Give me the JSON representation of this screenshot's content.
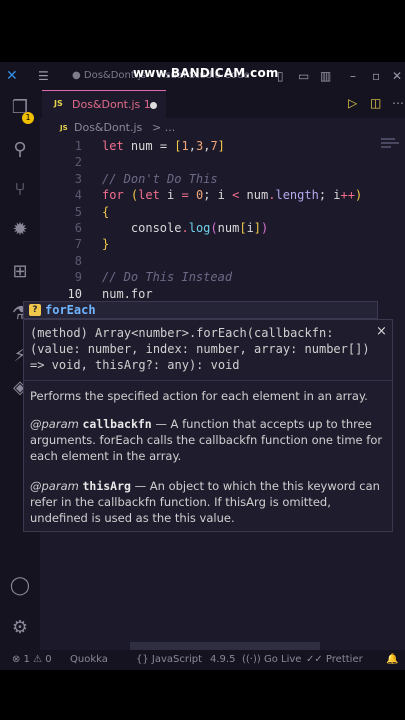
{
  "watermark": "www.BANDICAM.com",
  "window": {
    "title": "● Dos&Dont.js - Visual Studio Code"
  },
  "activity_bar": {
    "badge": "1",
    "items": [
      "files-icon",
      "search-icon",
      "source-control-icon",
      "debug-icon",
      "extensions-icon",
      "testing-icon",
      "remote-icon",
      "git-icon",
      "account-icon",
      "settings-icon"
    ]
  },
  "tab": {
    "icon": "JS",
    "label": "Dos&Dont.js 1"
  },
  "breadcrumb": {
    "icon": "JS",
    "file": "Dos&Dont.js",
    "sep": "> ..."
  },
  "code": [
    {
      "n": "1",
      "tokens": [
        [
          "kw",
          "let "
        ],
        [
          "id",
          "num "
        ],
        [
          "id",
          "= "
        ],
        [
          "br1",
          "["
        ],
        [
          "num",
          "1"
        ],
        [
          "id",
          ","
        ],
        [
          "num",
          "3"
        ],
        [
          "id",
          ","
        ],
        [
          "num",
          "7"
        ],
        [
          "br1",
          "]"
        ]
      ]
    },
    {
      "n": "2",
      "tokens": []
    },
    {
      "n": "3",
      "tokens": [
        [
          "cmt",
          "// Don't Do This"
        ]
      ]
    },
    {
      "n": "4",
      "tokens": [
        [
          "kw",
          "for "
        ],
        [
          "br1",
          "("
        ],
        [
          "kw",
          "let "
        ],
        [
          "id",
          "i "
        ],
        [
          "kw",
          "= "
        ],
        [
          "num",
          "0"
        ],
        [
          "id",
          "; i "
        ],
        [
          "kw",
          "< "
        ],
        [
          "id",
          "num"
        ],
        [
          "kw",
          "."
        ],
        [
          "prop",
          "length"
        ],
        [
          "id",
          "; i"
        ],
        [
          "kw",
          "++"
        ],
        [
          "br1",
          ")"
        ]
      ]
    },
    {
      "n": "5",
      "tokens": [
        [
          "br1",
          "{"
        ]
      ]
    },
    {
      "n": "6",
      "tokens": [
        [
          "id",
          "    console"
        ],
        [
          "kw",
          "."
        ],
        [
          "fn",
          "log"
        ],
        [
          "br2",
          "("
        ],
        [
          "id",
          "num"
        ],
        [
          "br1",
          "["
        ],
        [
          "id",
          "i"
        ],
        [
          "br1",
          "]"
        ],
        [
          "br2",
          ")"
        ]
      ]
    },
    {
      "n": "7",
      "tokens": [
        [
          "br1",
          "}"
        ]
      ]
    },
    {
      "n": "8",
      "tokens": []
    },
    {
      "n": "9",
      "tokens": [
        [
          "cmt",
          "// Do This Instead"
        ]
      ]
    },
    {
      "n": "10",
      "tokens": [
        [
          "id",
          "num.for"
        ]
      ]
    }
  ],
  "suggestion": {
    "icon": "?",
    "label": "forEach"
  },
  "hover": {
    "signature": "(method) Array<number>.forEach(callbackfn: (value: number, index: number, array: number[]) => void, thisArg?: any): void",
    "description": "Performs the specified action for each element in an array.",
    "param1_tag": "@param",
    "param1_name": "callbackfn",
    "param1_text": " — A function that accepts up to three arguments. forEach calls the callbackfn function one time for each element in the array.",
    "param2_tag": "@param",
    "param2_name": "thisArg",
    "param2_text": " — An object to which the this keyword can refer in the callbackfn function. If thisArg is omitted, undefined is used as the this value.",
    "close": "×"
  },
  "status": {
    "problems": "⊗ 1 ⚠ 0",
    "quokka": "Quokka",
    "language": "{} JavaScript",
    "version": "4.9.5",
    "golive": "((·)) Go Live",
    "prettier": "✓✓ Prettier"
  }
}
